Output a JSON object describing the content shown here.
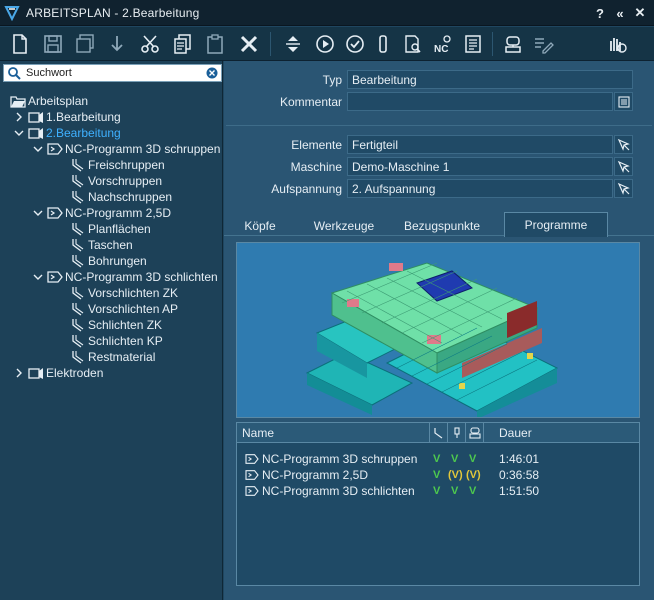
{
  "window": {
    "title": "ARBEITSPLAN - 2.Bearbeitung",
    "help_label": "?",
    "collapse_label": "«",
    "close_label": "✕"
  },
  "search": {
    "placeholder": "Suchwort",
    "value": "Suchwort"
  },
  "tree": {
    "root": "Arbeitsplan",
    "items": [
      {
        "label": "1.Bearbeitung"
      },
      {
        "label": "2.Bearbeitung"
      },
      {
        "label": "NC-Programm 3D schruppen"
      },
      {
        "label": "Freischruppen"
      },
      {
        "label": "Vorschruppen"
      },
      {
        "label": "Nachschruppen"
      },
      {
        "label": "NC-Programm 2,5D"
      },
      {
        "label": "Planflächen"
      },
      {
        "label": "Taschen"
      },
      {
        "label": "Bohrungen"
      },
      {
        "label": "NC-Programm 3D schlichten"
      },
      {
        "label": "Vorschlichten ZK"
      },
      {
        "label": "Vorschlichten AP"
      },
      {
        "label": "Schlichten ZK"
      },
      {
        "label": "Schlichten KP"
      },
      {
        "label": "Restmaterial"
      },
      {
        "label": "Elektroden"
      }
    ]
  },
  "form": {
    "typ_label": "Typ",
    "typ_value": "Bearbeitung",
    "kommentar_label": "Kommentar",
    "kommentar_value": "",
    "elemente_label": "Elemente",
    "elemente_value": "Fertigteil",
    "maschine_label": "Maschine",
    "maschine_value": "Demo-Maschine 1",
    "aufspannung_label": "Aufspannung",
    "aufspannung_value": "2. Aufspannung"
  },
  "tabs": [
    {
      "label": "Köpfe"
    },
    {
      "label": "Werkzeuge"
    },
    {
      "label": "Bezugspunkte"
    },
    {
      "label": "Programme"
    }
  ],
  "programs": {
    "header_name": "Name",
    "header_duration": "Dauer",
    "rows": [
      {
        "name": "NC-Programm 3D schruppen",
        "s1": "V",
        "s2": "V",
        "s3": "V",
        "duration": "1:46:01"
      },
      {
        "name": "NC-Programm 2,5D",
        "s1": "V",
        "s2": "(V)",
        "s3": "(V)",
        "duration": "0:36:58"
      },
      {
        "name": "NC-Programm 3D schlichten",
        "s1": "V",
        "s2": "V",
        "s3": "V",
        "duration": "1:51:50"
      }
    ]
  },
  "toolbar": {
    "nc_label": "NC"
  },
  "colors": {
    "accent": "#3fb1ff",
    "ok": "#4ec94e",
    "warn": "#e2c73a",
    "background": "#2a5573"
  }
}
